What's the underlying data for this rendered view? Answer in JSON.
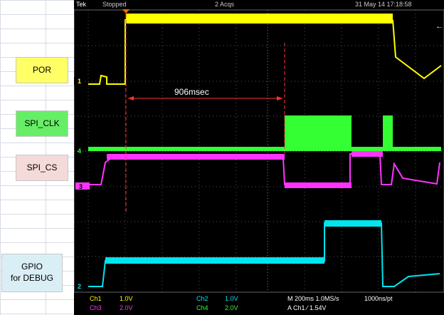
{
  "labels": {
    "por": "POR",
    "spi_clk": "SPI_CLK",
    "spi_cs": "SPI_CS",
    "gpio_line1": "GPIO",
    "gpio_line2": "for DEBUG"
  },
  "scope": {
    "brand": "Tek",
    "state": "Stopped",
    "acqs": "2 Acqs",
    "datetime": "31 May 14 17:18:58",
    "annotation": "906msec",
    "markers": {
      "ch1": "1",
      "ch4": "4",
      "ch3": "3",
      "ch2": "2"
    },
    "footer": {
      "ch1_label": "Ch1",
      "ch1_scale": "1.0V",
      "ch3_label": "Ch3",
      "ch3_scale": "2.0V",
      "ch2_label": "Ch2",
      "ch2_scale": "1.0V",
      "ch4_label": "Ch4",
      "ch4_scale": "2.0V",
      "timebase": "M 200ms 1.0MS/s",
      "record": "1000ns/pt",
      "trigger": "A  Ch1  ⁄  1.54V"
    },
    "colors": {
      "ch1": "#ffff00",
      "ch2": "#00e5ee",
      "ch3": "#ff33ff",
      "ch4": "#33ff33",
      "annotation": "#ff3333"
    }
  }
}
